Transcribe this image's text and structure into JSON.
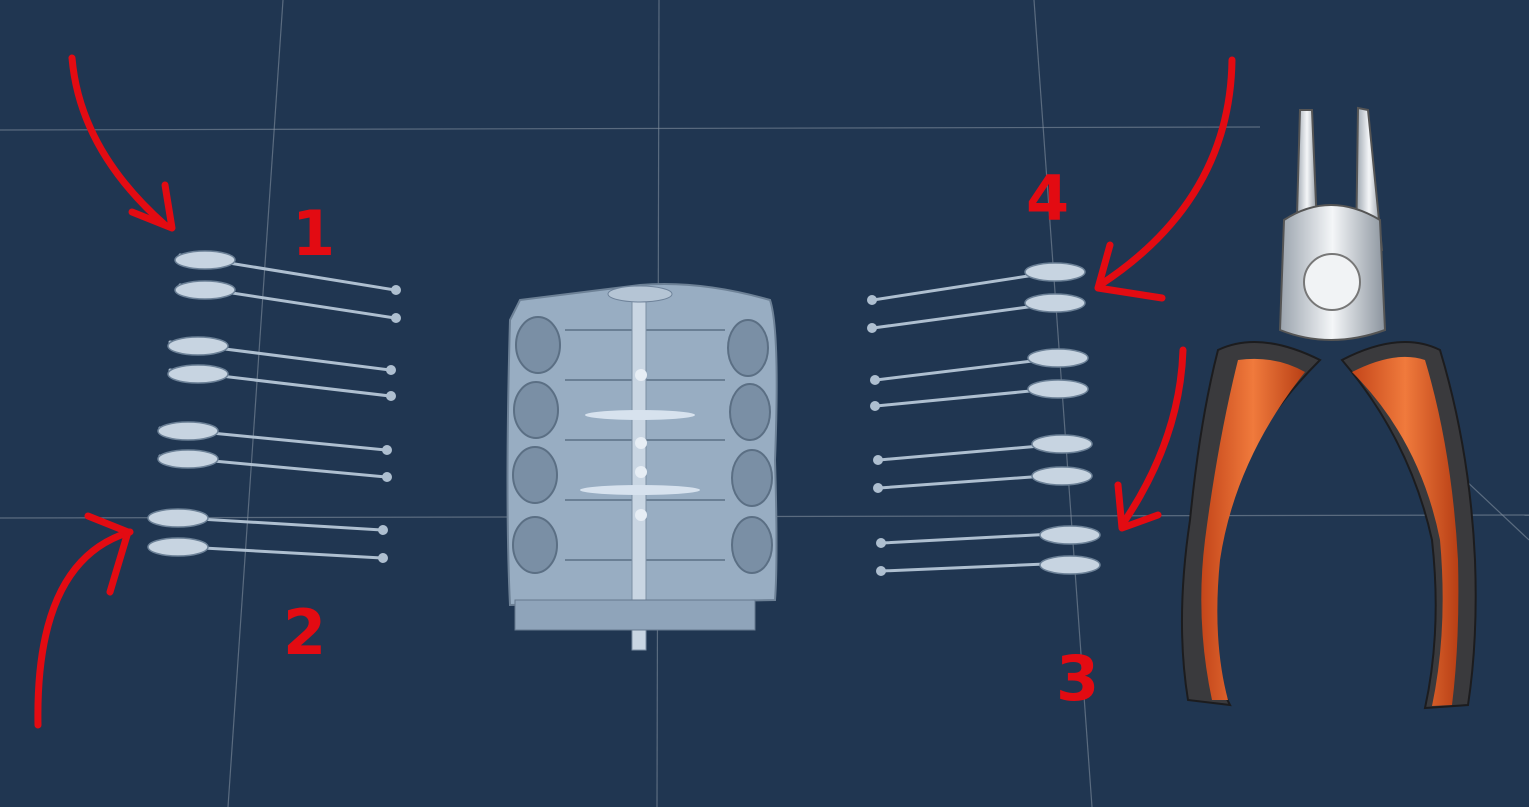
{
  "annotations": {
    "labels": [
      "1",
      "2",
      "3",
      "4"
    ],
    "color": "#e30b12"
  },
  "scene": {
    "background_color": "#203651",
    "grid_color": "#8a97a6",
    "part_color": "#b7c6d6",
    "objects": [
      "engine-block",
      "connecting-rod-group-1",
      "connecting-rod-group-2",
      "connecting-rod-group-3",
      "connecting-rod-group-4",
      "pliers-tool"
    ]
  }
}
